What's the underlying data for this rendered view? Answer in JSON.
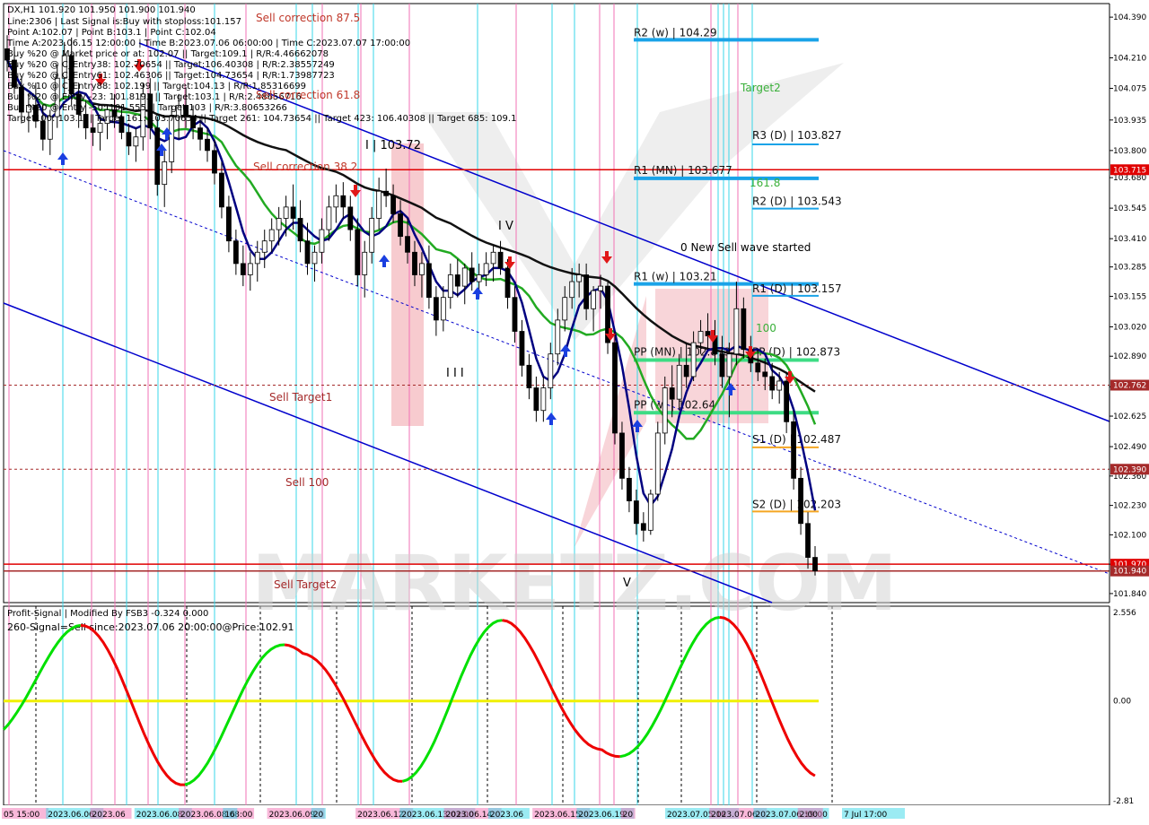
{
  "window": {
    "symbol_line": "DX,H1  101.920 101.950 101.900 101.940"
  },
  "info_lines": [
    "Line:2306 | Last Signal is:Buy with stoploss:101.157",
    "Point A:102.07 | Point B:103.1 | Point C:102.04",
    "Time A:2023.06.15 12:00:00 | Time B:2023.07.06 06:00:00 | Time C:2023.07.07 17:00:00",
    "Buy %20 @ Market price or at: 102.07 || Target:109.1 | R/R:4.46662078",
    "Buy %20 @ C_Entry38: 102.70654 || Target:106.40308 | R/R:2.38557249",
    "Buy %20 @ C_Entry61: 102.46306 || Target:104.73654 | R/R:1.73987723",
    "Buy %10 @ C_Entry88: 102.199 || Target:104.13 | R/R:1.85316699",
    "Buy %20 @ Entry -23: 101.8193 || Target:103.1 | R/R:2.48656716",
    "Buy %20 @ Entry -50: 101.555 || Target:103 | R/R:3.80653266",
    "Target100: 103.1 || Target 161: 103.70654 || Target 261: 104.73654 || Target 423: 106.40308 || Target 685: 109.1"
  ],
  "signal_labels": [
    {
      "text": "Sell correction 87.5"
    },
    {
      "text": "Sell correction 61.8"
    },
    {
      "text": "Sell correction 38.2"
    },
    {
      "text": "Sell Target1"
    },
    {
      "text": "Sell 100"
    },
    {
      "text": "Sell Target2"
    },
    {
      "text": "Target2"
    },
    {
      "text": "0 New Sell wave started"
    },
    {
      "text": "100"
    },
    {
      "text": "161.8"
    }
  ],
  "wave_labels": [
    {
      "text": "I | 103.72"
    },
    {
      "text": "I V"
    },
    {
      "text": "I I I"
    },
    {
      "text": "V"
    }
  ],
  "pivot_levels": [
    {
      "label": "R2 (w) | 104.29",
      "price": 104.29,
      "color": "#1aa3e8"
    },
    {
      "label": "R3 (D) | 103.827",
      "price": 103.827,
      "color": "#1aa3e8"
    },
    {
      "label": "R1 (MN) | 103.677",
      "price": 103.677,
      "color": "#1aa3e8"
    },
    {
      "label": "R2 (D) | 103.543",
      "price": 103.543,
      "color": "#1aa3e8"
    },
    {
      "label": "R1 (w) | 103.21",
      "price": 103.21,
      "color": "#1aa3e8"
    },
    {
      "label": "R1 (D) | 103.157",
      "price": 103.157,
      "color": "#1aa3e8"
    },
    {
      "label": "PP (MN) | 102.873",
      "price": 102.873,
      "color": "#3ddc84"
    },
    {
      "label": "PP (D) | 102.873",
      "price": 102.873,
      "color": "#3ddc84"
    },
    {
      "label": "PP (w) | 102.64",
      "price": 102.64,
      "color": "#3ddc84"
    },
    {
      "label": "S1 (D) | 102.487",
      "price": 102.487,
      "color": "#f5a623"
    },
    {
      "label": "S2 (D) | 102.203",
      "price": 102.203,
      "color": "#f5a623"
    }
  ],
  "horizontal_lines": [
    {
      "price": 103.715,
      "label": "103.715",
      "color": "#e00000",
      "style": "solid"
    },
    {
      "price": 102.762,
      "label": "102.762",
      "color": "#a52a2a",
      "style": "dashed"
    },
    {
      "price": 102.39,
      "label": "102.390",
      "color": "#a52a2a",
      "style": "dashed"
    },
    {
      "price": 101.97,
      "label": "101.970",
      "color": "#e00000",
      "style": "solid"
    },
    {
      "price": 101.94,
      "label": "101.940",
      "color": "#a52a2a",
      "style": "solid"
    }
  ],
  "price_axis": {
    "ticks": [
      "104.390",
      "104.210",
      "104.075",
      "103.935",
      "103.800",
      "103.680",
      "103.545",
      "103.410",
      "103.285",
      "103.155",
      "103.020",
      "102.890",
      "102.755",
      "102.625",
      "102.490",
      "102.360",
      "102.230",
      "102.100",
      "101.970",
      "101.840"
    ],
    "min": 101.8,
    "max": 104.45
  },
  "time_axis": {
    "labels": [
      "05 15:00",
      "2023.06.06",
      "2023.06",
      "2023.06.08",
      "2023.06.08 08:00",
      "16",
      "2023.06.09",
      "20",
      "2023.06.12",
      "2023.06.13 03:00",
      "2023.06.14",
      "2023.06",
      "2023.06.15",
      "2023.06.19",
      "20",
      "2023.07.05 16",
      "2023.07.06",
      "2023.07.06 19:00",
      "2:00",
      "7 Jul 17:00"
    ]
  },
  "indicator": {
    "title": "Profit-Signal | Modified By FSB3 -0.324 0.000",
    "signal_text": "260-Signal=Sell since:2023.07.06 20:00:00@Price:102.91",
    "axis_ticks": [
      "2.556",
      "0.00",
      "-2.81"
    ],
    "min": -2.81,
    "max": 2.556
  },
  "watermark": "MARKETZ.COM",
  "colors": {
    "bull_candle": "#000000",
    "bear_candle": "#000000",
    "fast_ma": "#000080",
    "mid_ma": "#22aa22",
    "slow_ma": "#111111",
    "channel": "#0000cc",
    "osc_up": "#00e000",
    "osc_down": "#ee0000",
    "zero_line": "#f0f000"
  },
  "chart_data": {
    "type": "candlestick",
    "title": "DX,H1",
    "ylim": [
      101.8,
      104.45
    ],
    "ohlc": [
      [
        104.25,
        104.31,
        104.15,
        104.2
      ],
      [
        104.2,
        104.26,
        104.05,
        104.08
      ],
      [
        104.08,
        104.12,
        103.92,
        103.97
      ],
      [
        103.97,
        104.05,
        103.88,
        104.0
      ],
      [
        104.0,
        104.1,
        103.9,
        103.93
      ],
      [
        103.93,
        104.0,
        103.8,
        103.85
      ],
      [
        103.85,
        103.98,
        103.78,
        103.95
      ],
      [
        103.95,
        104.18,
        103.9,
        104.12
      ],
      [
        104.12,
        104.28,
        104.05,
        104.22
      ],
      [
        104.22,
        104.3,
        104.0,
        104.05
      ],
      [
        104.05,
        104.1,
        103.9,
        103.96
      ],
      [
        103.96,
        104.02,
        103.85,
        103.9
      ],
      [
        103.9,
        103.96,
        103.82,
        103.88
      ],
      [
        103.88,
        103.95,
        103.8,
        103.92
      ],
      [
        103.92,
        104.0,
        103.85,
        103.98
      ],
      [
        103.98,
        104.05,
        103.9,
        103.95
      ],
      [
        103.95,
        104.0,
        103.85,
        103.88
      ],
      [
        103.88,
        103.92,
        103.78,
        103.82
      ],
      [
        103.82,
        103.9,
        103.75,
        103.86
      ],
      [
        103.86,
        104.1,
        103.8,
        104.05
      ],
      [
        104.05,
        104.12,
        103.85,
        103.9
      ],
      [
        103.9,
        103.95,
        103.6,
        103.65
      ],
      [
        103.65,
        103.8,
        103.55,
        103.75
      ],
      [
        103.75,
        104.0,
        103.7,
        103.95
      ],
      [
        103.95,
        104.05,
        103.85,
        104.0
      ],
      [
        104.0,
        104.08,
        103.9,
        103.95
      ],
      [
        103.95,
        104.0,
        103.85,
        103.9
      ],
      [
        103.9,
        103.95,
        103.8,
        103.85
      ],
      [
        103.85,
        103.9,
        103.75,
        103.8
      ],
      [
        103.8,
        103.85,
        103.65,
        103.7
      ],
      [
        103.7,
        103.75,
        103.5,
        103.55
      ],
      [
        103.55,
        103.6,
        103.35,
        103.4
      ],
      [
        103.4,
        103.45,
        103.25,
        103.3
      ],
      [
        103.3,
        103.38,
        103.2,
        103.25
      ],
      [
        103.25,
        103.35,
        103.18,
        103.3
      ],
      [
        103.3,
        103.4,
        103.22,
        103.35
      ],
      [
        103.35,
        103.45,
        103.28,
        103.4
      ],
      [
        103.4,
        103.5,
        103.35,
        103.45
      ],
      [
        103.45,
        103.55,
        103.38,
        103.5
      ],
      [
        103.5,
        103.6,
        103.42,
        103.55
      ],
      [
        103.55,
        103.65,
        103.45,
        103.5
      ],
      [
        103.5,
        103.58,
        103.35,
        103.4
      ],
      [
        103.4,
        103.48,
        103.25,
        103.3
      ],
      [
        103.3,
        103.38,
        103.22,
        103.35
      ],
      [
        103.35,
        103.5,
        103.3,
        103.45
      ],
      [
        103.45,
        103.6,
        103.4,
        103.55
      ],
      [
        103.55,
        103.65,
        103.48,
        103.6
      ],
      [
        103.6,
        103.66,
        103.5,
        103.55
      ],
      [
        103.55,
        103.6,
        103.4,
        103.45
      ],
      [
        103.45,
        103.5,
        103.2,
        103.25
      ],
      [
        103.25,
        103.4,
        103.15,
        103.35
      ],
      [
        103.35,
        103.55,
        103.3,
        103.5
      ],
      [
        103.5,
        103.68,
        103.45,
        103.62
      ],
      [
        103.62,
        103.72,
        103.55,
        103.6
      ],
      [
        103.6,
        103.65,
        103.48,
        103.52
      ],
      [
        103.52,
        103.58,
        103.38,
        103.42
      ],
      [
        103.42,
        103.5,
        103.3,
        103.35
      ],
      [
        103.35,
        103.4,
        103.2,
        103.25
      ],
      [
        103.25,
        103.35,
        103.15,
        103.3
      ],
      [
        103.3,
        103.38,
        103.1,
        103.15
      ],
      [
        103.15,
        103.2,
        102.98,
        103.05
      ],
      [
        103.05,
        103.2,
        103.0,
        103.15
      ],
      [
        103.15,
        103.3,
        103.1,
        103.25
      ],
      [
        103.25,
        103.32,
        103.15,
        103.2
      ],
      [
        103.2,
        103.3,
        103.12,
        103.28
      ],
      [
        103.28,
        103.35,
        103.18,
        103.22
      ],
      [
        103.22,
        103.3,
        103.15,
        103.25
      ],
      [
        103.25,
        103.35,
        103.2,
        103.3
      ],
      [
        103.3,
        103.38,
        103.22,
        103.35
      ],
      [
        103.35,
        103.4,
        103.25,
        103.28
      ],
      [
        103.28,
        103.32,
        103.1,
        103.15
      ],
      [
        103.15,
        103.2,
        102.95,
        103.0
      ],
      [
        103.0,
        103.05,
        102.8,
        102.85
      ],
      [
        102.85,
        102.9,
        102.7,
        102.75
      ],
      [
        102.75,
        102.8,
        102.6,
        102.65
      ],
      [
        102.65,
        102.8,
        102.6,
        102.75
      ],
      [
        102.75,
        102.95,
        102.7,
        102.9
      ],
      [
        102.9,
        103.1,
        102.85,
        103.05
      ],
      [
        103.05,
        103.2,
        103.0,
        103.15
      ],
      [
        103.15,
        103.28,
        103.1,
        103.22
      ],
      [
        103.22,
        103.3,
        103.15,
        103.25
      ],
      [
        103.25,
        103.3,
        103.05,
        103.1
      ],
      [
        103.1,
        103.2,
        103.0,
        103.18
      ],
      [
        103.18,
        103.25,
        103.1,
        103.2
      ],
      [
        103.2,
        103.22,
        102.9,
        102.95
      ],
      [
        102.95,
        103.0,
        102.5,
        102.55
      ],
      [
        102.55,
        102.6,
        102.3,
        102.35
      ],
      [
        102.35,
        102.4,
        102.2,
        102.25
      ],
      [
        102.25,
        102.3,
        102.1,
        102.15
      ],
      [
        102.15,
        102.2,
        102.07,
        102.12
      ],
      [
        102.12,
        102.3,
        102.1,
        102.28
      ],
      [
        102.28,
        102.6,
        102.25,
        102.55
      ],
      [
        102.55,
        102.8,
        102.5,
        102.75
      ],
      [
        102.75,
        102.85,
        102.62,
        102.7
      ],
      [
        102.7,
        102.9,
        102.65,
        102.85
      ],
      [
        102.85,
        102.95,
        102.75,
        102.8
      ],
      [
        102.8,
        103.0,
        102.78,
        102.95
      ],
      [
        102.95,
        103.05,
        102.9,
        103.0
      ],
      [
        103.0,
        103.08,
        102.92,
        102.98
      ],
      [
        102.98,
        103.05,
        102.85,
        102.9
      ],
      [
        102.9,
        102.98,
        102.75,
        102.8
      ],
      [
        102.8,
        102.95,
        102.62,
        102.9
      ],
      [
        102.9,
        103.22,
        102.85,
        103.1
      ],
      [
        103.1,
        103.15,
        102.88,
        102.92
      ],
      [
        102.92,
        102.98,
        102.82,
        102.86
      ],
      [
        102.86,
        102.92,
        102.78,
        102.82
      ],
      [
        102.82,
        102.88,
        102.74,
        102.8
      ],
      [
        102.8,
        102.86,
        102.7,
        102.74
      ],
      [
        102.74,
        102.82,
        102.68,
        102.78
      ],
      [
        102.78,
        102.82,
        102.55,
        102.6
      ],
      [
        102.6,
        102.65,
        102.3,
        102.35
      ],
      [
        102.35,
        102.4,
        102.1,
        102.15
      ],
      [
        102.15,
        102.2,
        101.95,
        102.0
      ],
      [
        102.0,
        102.05,
        101.92,
        101.94
      ]
    ]
  }
}
